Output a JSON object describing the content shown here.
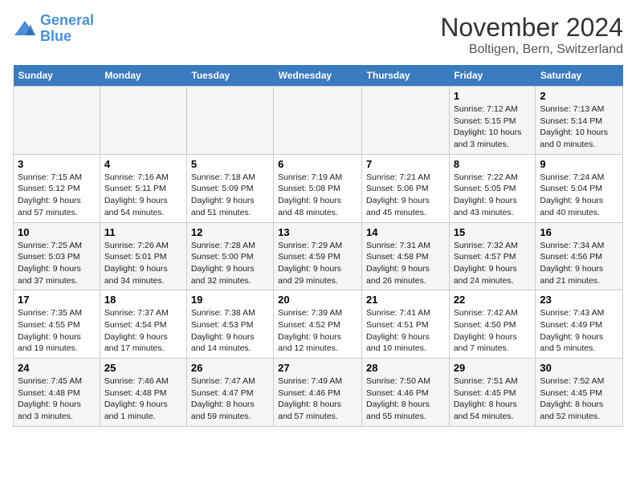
{
  "logo": {
    "line1": "General",
    "line2": "Blue"
  },
  "title": "November 2024",
  "location": "Boltigen, Bern, Switzerland",
  "weekdays": [
    "Sunday",
    "Monday",
    "Tuesday",
    "Wednesday",
    "Thursday",
    "Friday",
    "Saturday"
  ],
  "weeks": [
    [
      {
        "day": "",
        "info": ""
      },
      {
        "day": "",
        "info": ""
      },
      {
        "day": "",
        "info": ""
      },
      {
        "day": "",
        "info": ""
      },
      {
        "day": "",
        "info": ""
      },
      {
        "day": "1",
        "info": "Sunrise: 7:12 AM\nSunset: 5:15 PM\nDaylight: 10 hours\nand 3 minutes."
      },
      {
        "day": "2",
        "info": "Sunrise: 7:13 AM\nSunset: 5:14 PM\nDaylight: 10 hours\nand 0 minutes."
      }
    ],
    [
      {
        "day": "3",
        "info": "Sunrise: 7:15 AM\nSunset: 5:12 PM\nDaylight: 9 hours\nand 57 minutes."
      },
      {
        "day": "4",
        "info": "Sunrise: 7:16 AM\nSunset: 5:11 PM\nDaylight: 9 hours\nand 54 minutes."
      },
      {
        "day": "5",
        "info": "Sunrise: 7:18 AM\nSunset: 5:09 PM\nDaylight: 9 hours\nand 51 minutes."
      },
      {
        "day": "6",
        "info": "Sunrise: 7:19 AM\nSunset: 5:08 PM\nDaylight: 9 hours\nand 48 minutes."
      },
      {
        "day": "7",
        "info": "Sunrise: 7:21 AM\nSunset: 5:06 PM\nDaylight: 9 hours\nand 45 minutes."
      },
      {
        "day": "8",
        "info": "Sunrise: 7:22 AM\nSunset: 5:05 PM\nDaylight: 9 hours\nand 43 minutes."
      },
      {
        "day": "9",
        "info": "Sunrise: 7:24 AM\nSunset: 5:04 PM\nDaylight: 9 hours\nand 40 minutes."
      }
    ],
    [
      {
        "day": "10",
        "info": "Sunrise: 7:25 AM\nSunset: 5:03 PM\nDaylight: 9 hours\nand 37 minutes."
      },
      {
        "day": "11",
        "info": "Sunrise: 7:26 AM\nSunset: 5:01 PM\nDaylight: 9 hours\nand 34 minutes."
      },
      {
        "day": "12",
        "info": "Sunrise: 7:28 AM\nSunset: 5:00 PM\nDaylight: 9 hours\nand 32 minutes."
      },
      {
        "day": "13",
        "info": "Sunrise: 7:29 AM\nSunset: 4:59 PM\nDaylight: 9 hours\nand 29 minutes."
      },
      {
        "day": "14",
        "info": "Sunrise: 7:31 AM\nSunset: 4:58 PM\nDaylight: 9 hours\nand 26 minutes."
      },
      {
        "day": "15",
        "info": "Sunrise: 7:32 AM\nSunset: 4:57 PM\nDaylight: 9 hours\nand 24 minutes."
      },
      {
        "day": "16",
        "info": "Sunrise: 7:34 AM\nSunset: 4:56 PM\nDaylight: 9 hours\nand 21 minutes."
      }
    ],
    [
      {
        "day": "17",
        "info": "Sunrise: 7:35 AM\nSunset: 4:55 PM\nDaylight: 9 hours\nand 19 minutes."
      },
      {
        "day": "18",
        "info": "Sunrise: 7:37 AM\nSunset: 4:54 PM\nDaylight: 9 hours\nand 17 minutes."
      },
      {
        "day": "19",
        "info": "Sunrise: 7:38 AM\nSunset: 4:53 PM\nDaylight: 9 hours\nand 14 minutes."
      },
      {
        "day": "20",
        "info": "Sunrise: 7:39 AM\nSunset: 4:52 PM\nDaylight: 9 hours\nand 12 minutes."
      },
      {
        "day": "21",
        "info": "Sunrise: 7:41 AM\nSunset: 4:51 PM\nDaylight: 9 hours\nand 10 minutes."
      },
      {
        "day": "22",
        "info": "Sunrise: 7:42 AM\nSunset: 4:50 PM\nDaylight: 9 hours\nand 7 minutes."
      },
      {
        "day": "23",
        "info": "Sunrise: 7:43 AM\nSunset: 4:49 PM\nDaylight: 9 hours\nand 5 minutes."
      }
    ],
    [
      {
        "day": "24",
        "info": "Sunrise: 7:45 AM\nSunset: 4:48 PM\nDaylight: 9 hours\nand 3 minutes."
      },
      {
        "day": "25",
        "info": "Sunrise: 7:46 AM\nSunset: 4:48 PM\nDaylight: 9 hours\nand 1 minute."
      },
      {
        "day": "26",
        "info": "Sunrise: 7:47 AM\nSunset: 4:47 PM\nDaylight: 8 hours\nand 59 minutes."
      },
      {
        "day": "27",
        "info": "Sunrise: 7:49 AM\nSunset: 4:46 PM\nDaylight: 8 hours\nand 57 minutes."
      },
      {
        "day": "28",
        "info": "Sunrise: 7:50 AM\nSunset: 4:46 PM\nDaylight: 8 hours\nand 55 minutes."
      },
      {
        "day": "29",
        "info": "Sunrise: 7:51 AM\nSunset: 4:45 PM\nDaylight: 8 hours\nand 54 minutes."
      },
      {
        "day": "30",
        "info": "Sunrise: 7:52 AM\nSunset: 4:45 PM\nDaylight: 8 hours\nand 52 minutes."
      }
    ]
  ]
}
